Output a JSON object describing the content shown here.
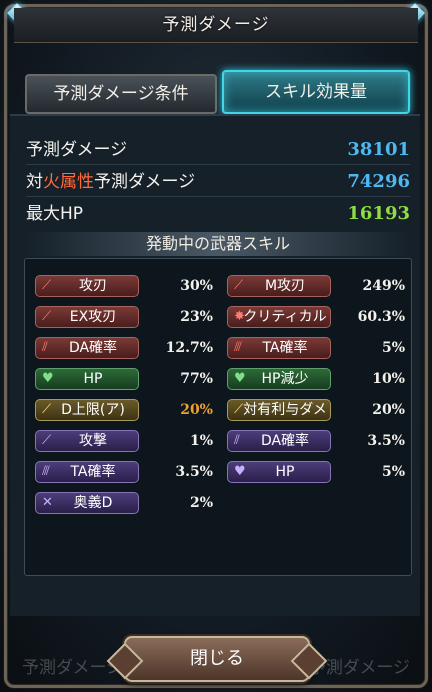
{
  "title": "予測ダメージ",
  "tabs": [
    {
      "label": "予測ダメージ条件",
      "active": false
    },
    {
      "label": "スキル効果量",
      "active": true
    }
  ],
  "stats": [
    {
      "label": "予測ダメージ",
      "label_prefix": "",
      "label_highlight": "",
      "label_suffix": "",
      "value": "38101",
      "color": "#4fb8f0"
    },
    {
      "label": "",
      "label_prefix": "対",
      "label_highlight": "火属性",
      "label_suffix": "予測ダメージ",
      "value": "74296",
      "color": "#4fb8f0"
    },
    {
      "label": "最大HP",
      "label_prefix": "",
      "label_highlight": "",
      "label_suffix": "",
      "value": "16193",
      "color": "#8fdc44"
    }
  ],
  "highlight_color": "#ff6a3c",
  "section_title": "発動中の武器スキル",
  "skills_left": [
    {
      "label": "攻刃",
      "value": "30%",
      "style": "red",
      "icon": "sword-icon",
      "value_color": "#f4f2ec"
    },
    {
      "label": "EX攻刃",
      "value": "23%",
      "style": "red",
      "icon": "sword-icon",
      "value_color": "#f4f2ec"
    },
    {
      "label": "DA確率",
      "value": "12.7%",
      "style": "red",
      "icon": "double-slash-icon",
      "value_color": "#f4f2ec"
    },
    {
      "label": "HP",
      "value": "77%",
      "style": "green",
      "icon": "heart-icon",
      "value_color": "#f4f2ec"
    },
    {
      "label": "D上限(ア)",
      "value": "20%",
      "style": "gold",
      "icon": "sword-up-icon",
      "value_color": "#f0a030"
    },
    {
      "label": "攻撃",
      "value": "1%",
      "style": "purple",
      "icon": "sword-icon",
      "value_color": "#f4f2ec"
    },
    {
      "label": "TA確率",
      "value": "3.5%",
      "style": "purple",
      "icon": "triple-slash-icon",
      "value_color": "#f4f2ec"
    },
    {
      "label": "奥義D",
      "value": "2%",
      "style": "purple",
      "icon": "cross-swords-icon",
      "value_color": "#f4f2ec"
    }
  ],
  "skills_right": [
    {
      "label": "M攻刃",
      "value": "249%",
      "style": "red",
      "icon": "sword-icon",
      "value_color": "#f4f2ec"
    },
    {
      "label": "クリティカル",
      "value": "60.3%",
      "style": "red",
      "icon": "burst-icon",
      "value_color": "#f4f2ec"
    },
    {
      "label": "TA確率",
      "value": "5%",
      "style": "red",
      "icon": "triple-slash-icon",
      "value_color": "#f4f2ec"
    },
    {
      "label": "HP減少",
      "value": "10%",
      "style": "green",
      "icon": "heart-icon",
      "value_color": "#f4f2ec"
    },
    {
      "label": "対有利与ダメ",
      "value": "20%",
      "style": "gold",
      "icon": "sword-up-icon",
      "value_color": "#f4f2ec"
    },
    {
      "label": "DA確率",
      "value": "3.5%",
      "style": "purple",
      "icon": "double-slash-icon",
      "value_color": "#f4f2ec"
    },
    {
      "label": "HP",
      "value": "5%",
      "style": "purple",
      "icon": "heart-icon",
      "value_color": "#f4f2ec"
    }
  ],
  "close_label": "閉じる",
  "background_labels": [
    "予測ダメージ",
    "予測ダメージ"
  ]
}
